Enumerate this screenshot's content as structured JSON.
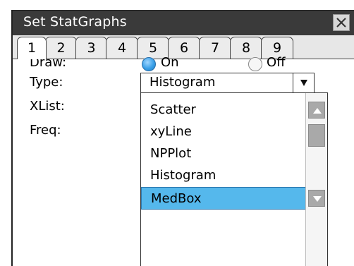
{
  "window": {
    "title": "Set StatGraphs",
    "close_icon": "close-icon"
  },
  "tabs": [
    {
      "label": "1",
      "active": true
    },
    {
      "label": "2"
    },
    {
      "label": "3"
    },
    {
      "label": "4"
    },
    {
      "label": "5"
    },
    {
      "label": "6"
    },
    {
      "label": "7"
    },
    {
      "label": "8"
    },
    {
      "label": "9"
    }
  ],
  "form": {
    "draw_label": "Draw:",
    "draw_on_label": "On",
    "draw_off_label": "Off",
    "draw_value": "On",
    "type_label": "Type:",
    "type_value": "Histogram",
    "xlist_label": "XList:",
    "freq_label": "Freq:"
  },
  "dropdown": {
    "options": [
      "Scatter",
      "xyLine",
      "NPPlot",
      "Histogram",
      "MedBox"
    ],
    "highlighted": "MedBox"
  },
  "colors": {
    "title_bar": "#3a3a3a",
    "selection": "#55b8ec",
    "radio_on": "#3aa0e8"
  }
}
